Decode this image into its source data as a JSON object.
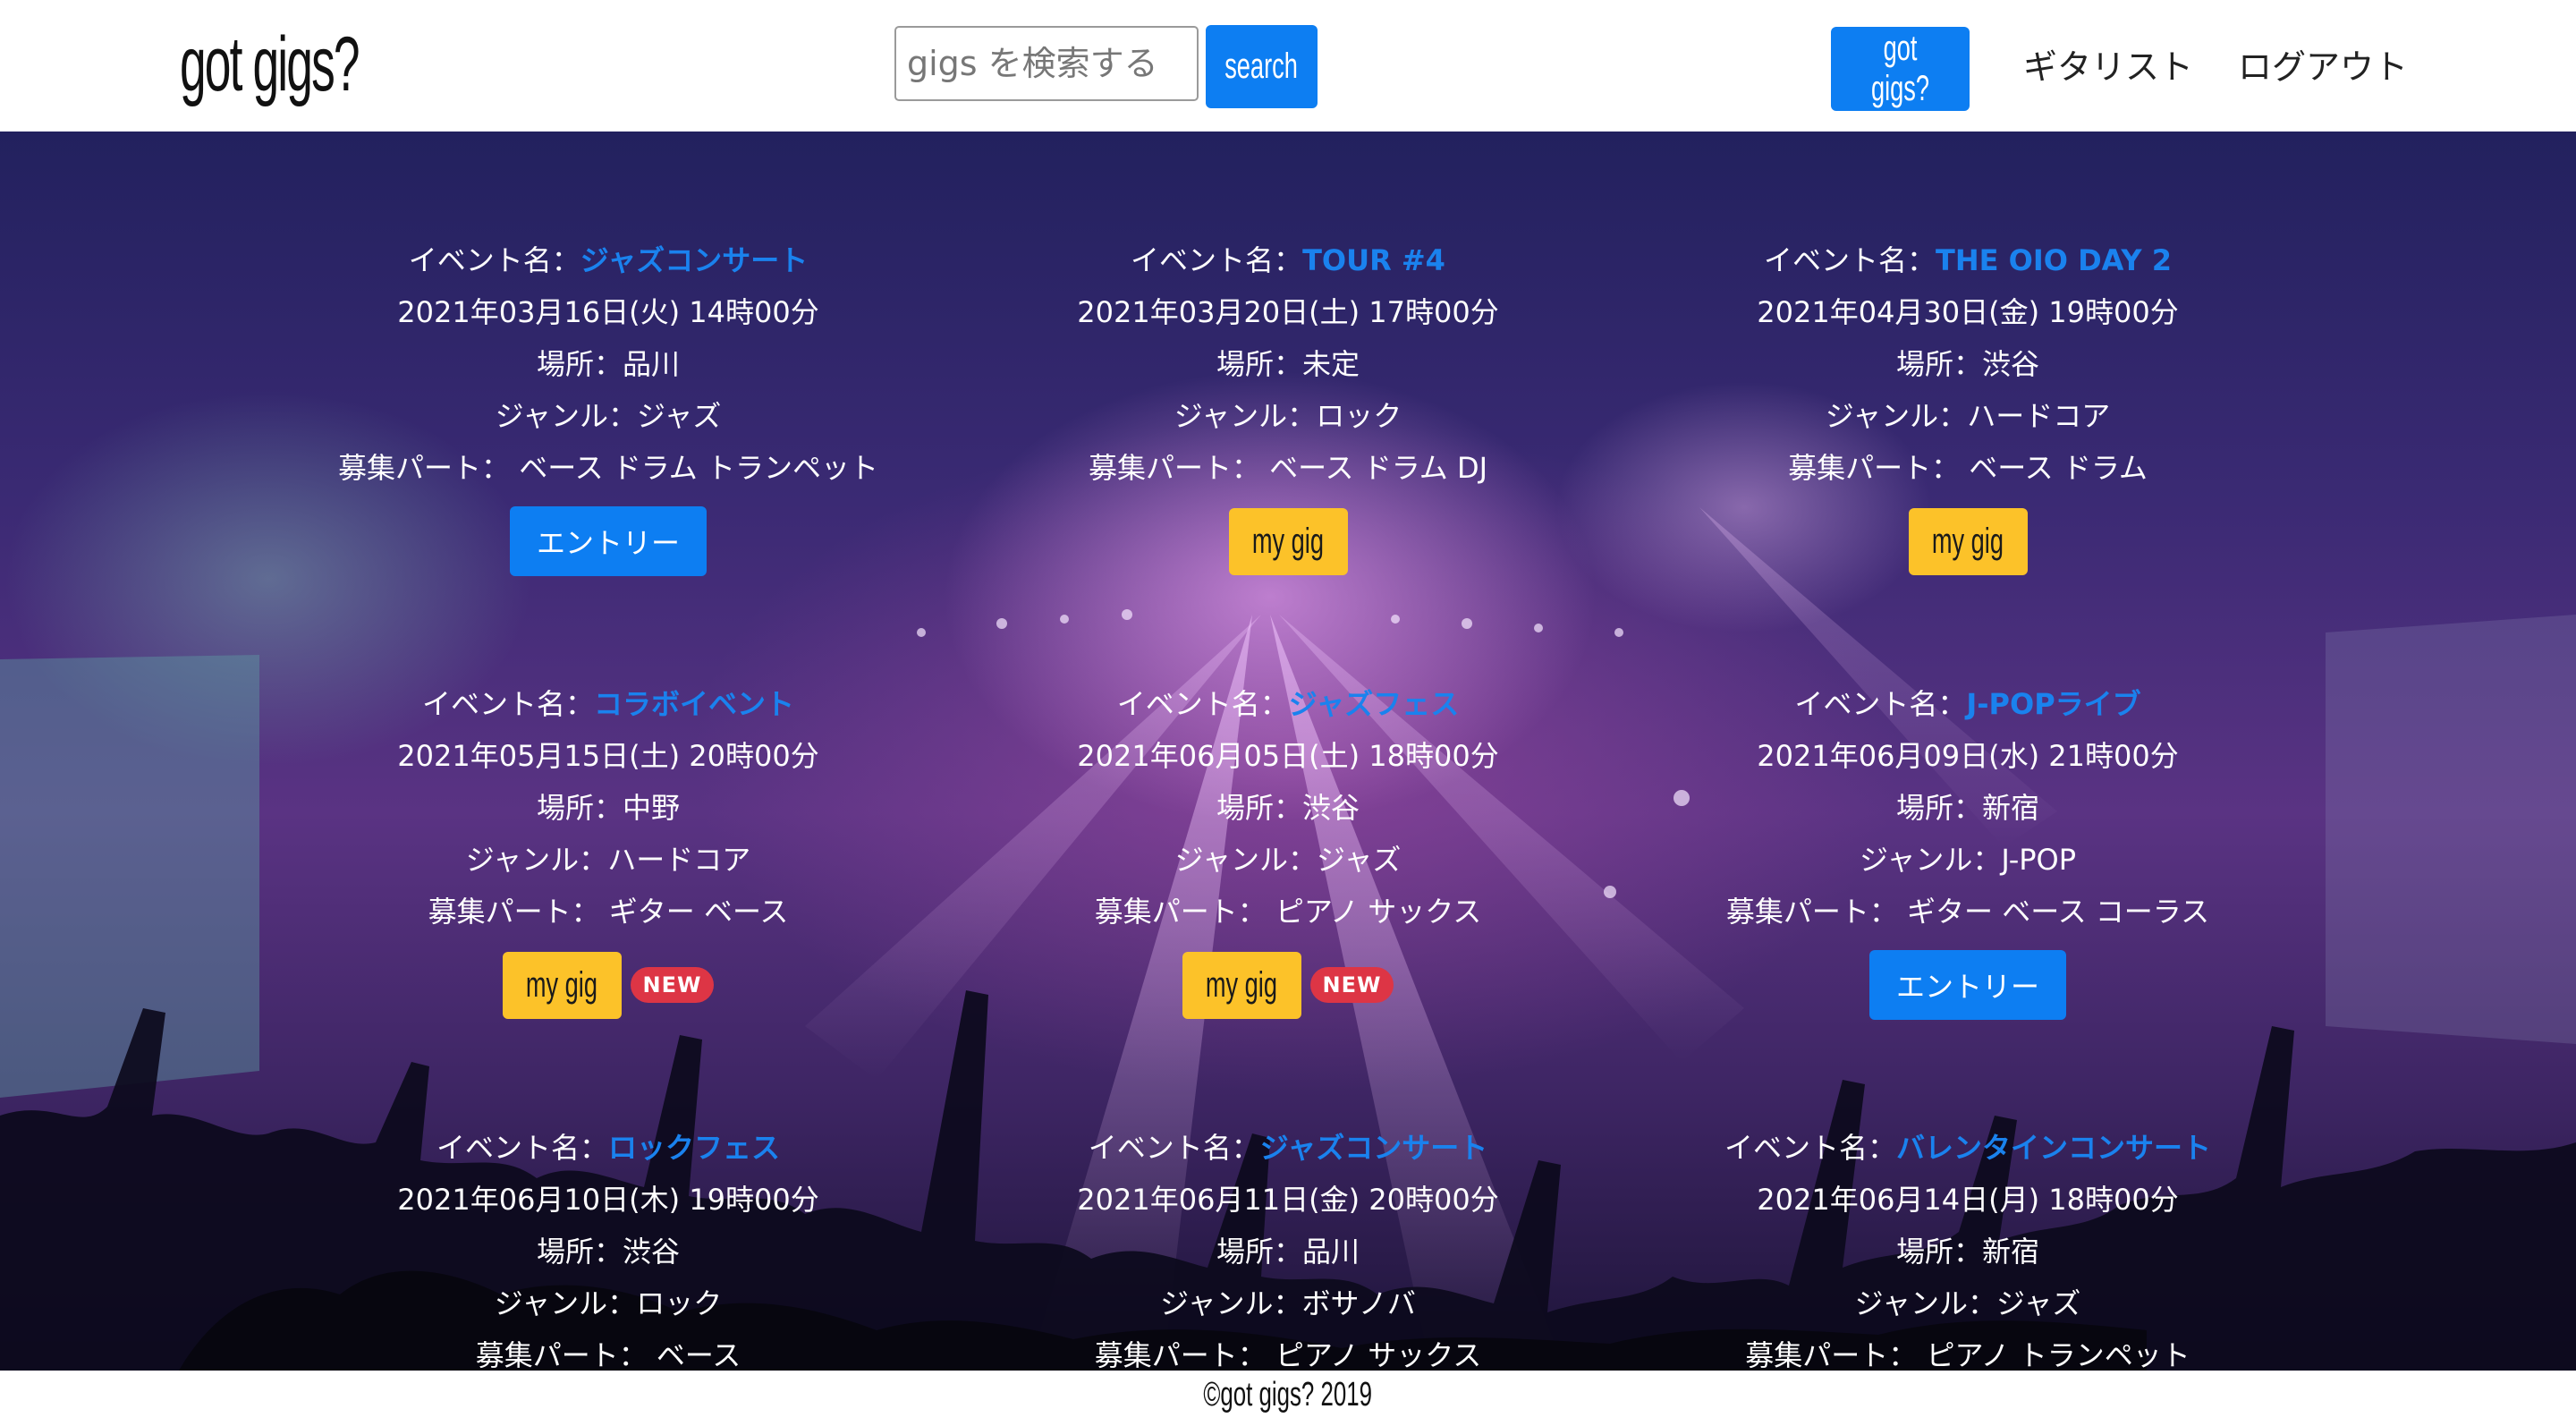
{
  "header": {
    "brand": "got gigs?",
    "search_placeholder": "gigs を検索する",
    "search_button": "search",
    "nav_button": "got gigs?",
    "nav_guitarist": "ギタリスト",
    "nav_logout": "ログアウト"
  },
  "colors": {
    "primary": "#0d7ef2",
    "warning": "#fcc229",
    "danger": "#dd3545",
    "link": "#1a82ee"
  },
  "labels": {
    "event_name": "イベント名：",
    "place": "場所：",
    "genre": "ジャンル：",
    "parts": "募集パート：",
    "entry": "エントリー",
    "my_gig": "my gig",
    "new": "NEW"
  },
  "events": [
    {
      "name": "ジャズコンサート",
      "datetime": "2021年03月16日(火) 14時00分",
      "place": "品川",
      "genre": "ジャズ",
      "parts": "ベース ドラム トランペット",
      "action": "entry",
      "is_new": false
    },
    {
      "name": "TOUR #4",
      "datetime": "2021年03月20日(土) 17時00分",
      "place": "未定",
      "genre": "ロック",
      "parts": "ベース ドラム DJ",
      "action": "my_gig",
      "is_new": false
    },
    {
      "name": "THE OIO DAY 2",
      "datetime": "2021年04月30日(金) 19時00分",
      "place": "渋谷",
      "genre": "ハードコア",
      "parts": "ベース ドラム",
      "action": "my_gig",
      "is_new": false
    },
    {
      "name": "コラボイベント",
      "datetime": "2021年05月15日(土) 20時00分",
      "place": "中野",
      "genre": "ハードコア",
      "parts": "ギター ベース",
      "action": "my_gig",
      "is_new": true
    },
    {
      "name": "ジャズフェス",
      "datetime": "2021年06月05日(土) 18時00分",
      "place": "渋谷",
      "genre": "ジャズ",
      "parts": "ピアノ サックス",
      "action": "my_gig",
      "is_new": true
    },
    {
      "name": "J-POPライブ",
      "datetime": "2021年06月09日(水) 21時00分",
      "place": "新宿",
      "genre": "J-POP",
      "parts": "ギター ベース コーラス",
      "action": "entry",
      "is_new": false
    },
    {
      "name": "ロックフェス",
      "datetime": "2021年06月10日(木) 19時00分",
      "place": "渋谷",
      "genre": "ロック",
      "parts": "ベース"
    },
    {
      "name": "ジャズコンサート",
      "datetime": "2021年06月11日(金) 20時00分",
      "place": "品川",
      "genre": "ボサノバ",
      "parts": "ピアノ サックス"
    },
    {
      "name": "バレンタインコンサート",
      "datetime": "2021年06月14日(月) 18時00分",
      "place": "新宿",
      "genre": "ジャズ",
      "parts": "ピアノ トランペット"
    }
  ],
  "footer": {
    "text": "©got gigs? 2019"
  }
}
